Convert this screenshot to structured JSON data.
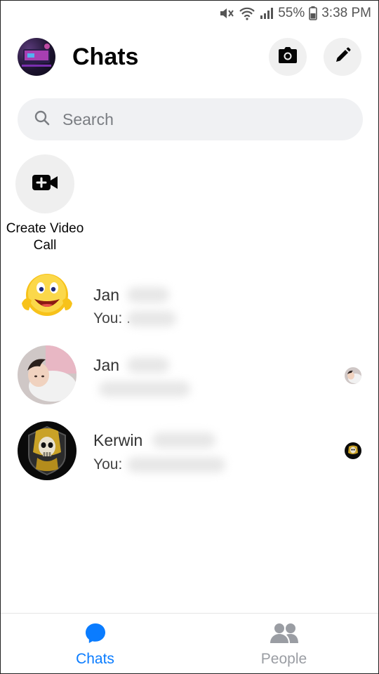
{
  "status_bar": {
    "battery": "55%",
    "time": "3:38 PM"
  },
  "header": {
    "title": "Chats",
    "icons": [
      "avatar",
      "camera-icon",
      "edit-pencil-icon"
    ]
  },
  "search": {
    "placeholder": "Search"
  },
  "create_video_call": {
    "label": "Create Video Call"
  },
  "chats": [
    {
      "name": "Jan",
      "preview": "You: ."
    },
    {
      "name": "Jan",
      "preview": ""
    },
    {
      "name": "Kerwin",
      "preview": "You:"
    }
  ],
  "bottom_nav": {
    "tabs": [
      {
        "label": "Chats",
        "active": true
      },
      {
        "label": "People",
        "active": false
      }
    ]
  },
  "colors": {
    "accent": "#0a7cff",
    "inactive": "#9a9da3",
    "button_bg": "#f0f0f0"
  }
}
